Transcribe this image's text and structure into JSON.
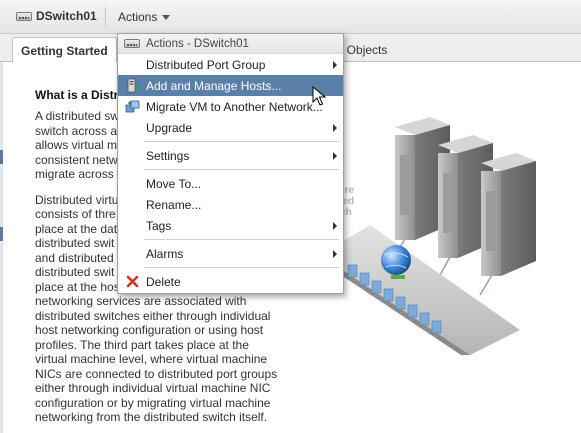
{
  "header": {
    "object_name": "DSwitch01",
    "actions_label": "Actions"
  },
  "tabs": [
    {
      "label": "Getting Started"
    },
    {
      "label": "ed Objects"
    }
  ],
  "content": {
    "heading": "What is a Distri",
    "para1_lines": [
      "A distributed sw",
      "switch across a",
      "allows virtual m",
      "consistent netw",
      "migrate across"
    ],
    "para2_lines": [
      "Distributed virtu",
      "consists of thre",
      "place at the dat",
      "distributed swit",
      "and distributed",
      "distributed swit",
      "place at the hos",
      "networking services are associated with",
      "distributed switches either through individual",
      "host networking configuration or using host",
      "profiles. The third part takes place at the",
      "virtual machine level, where virtual machine",
      "NICs are connected to distributed port groups",
      "either through individual virtual machine NIC",
      "configuration or by migrating virtual machine",
      "networking from the distributed switch itself."
    ]
  },
  "menu": {
    "header": "Actions - DSwitch01",
    "items": [
      {
        "label": "Distributed Port Group",
        "submenu": true,
        "icon": ""
      },
      {
        "label": "Add and Manage Hosts...",
        "submenu": false,
        "icon": "add-hosts-icon",
        "highlighted": true
      },
      {
        "label": "Migrate VM to Another Network...",
        "submenu": false,
        "icon": "migrate-vm-icon"
      },
      {
        "label": "Upgrade",
        "submenu": true,
        "icon": ""
      },
      {
        "label": "Settings",
        "submenu": true,
        "icon": ""
      },
      {
        "label": "Move To...",
        "submenu": false,
        "icon": ""
      },
      {
        "label": "Rename...",
        "submenu": false,
        "icon": ""
      },
      {
        "label": "Tags",
        "submenu": true,
        "icon": ""
      },
      {
        "label": "Alarms",
        "submenu": true,
        "icon": ""
      },
      {
        "label": "Delete",
        "submenu": false,
        "icon": "delete-icon"
      }
    ]
  },
  "illustration": {
    "partial_text_lines": [
      "here",
      "uted",
      "ch"
    ]
  },
  "colors": {
    "highlight": "#5a7fa8",
    "delete_red": "#d93025"
  }
}
